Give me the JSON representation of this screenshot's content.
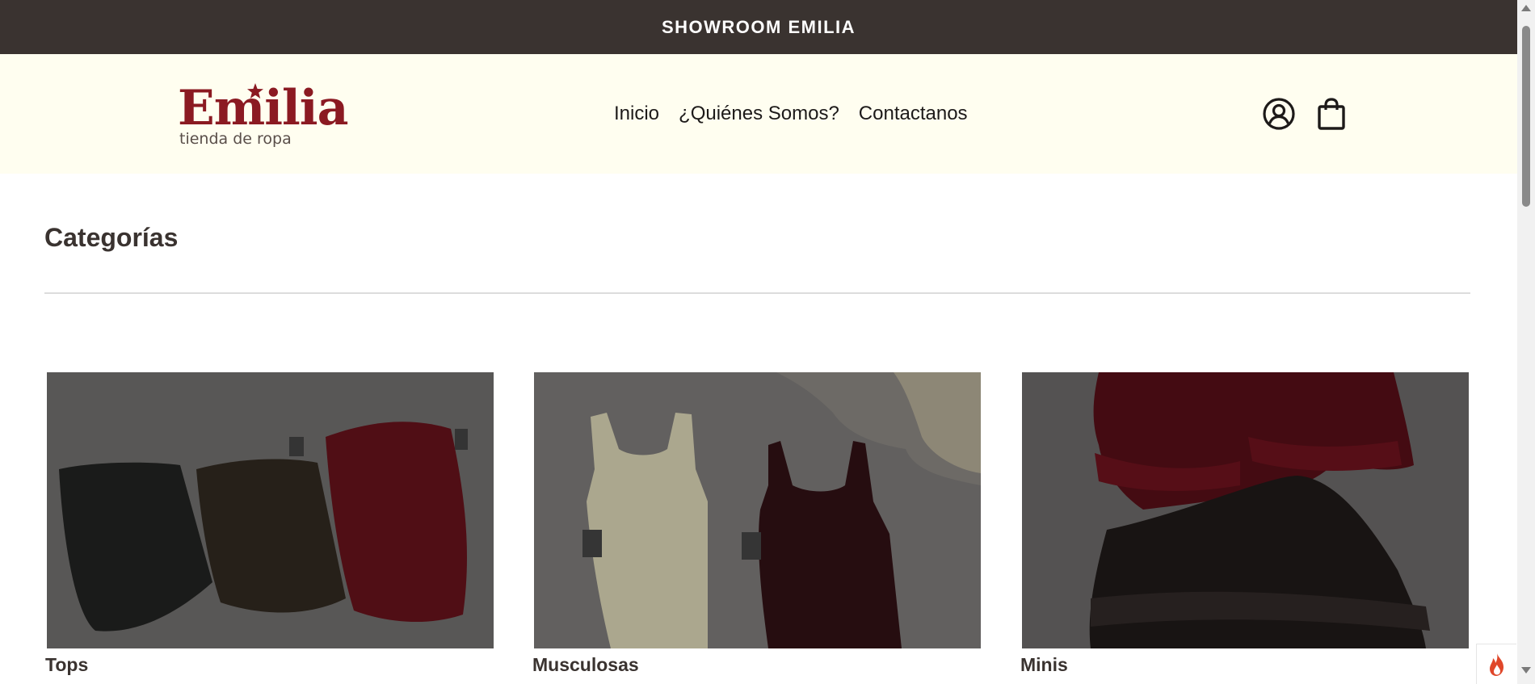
{
  "announcement": {
    "text": "SHOWROOM EMILIA"
  },
  "header": {
    "logo": {
      "word": "Emilia",
      "tagline": "tienda de ropa"
    },
    "nav": [
      {
        "label": "Inicio"
      },
      {
        "label": "¿Quiénes Somos?"
      },
      {
        "label": "Contactanos"
      }
    ],
    "icons": {
      "account": "account-circle-icon",
      "cart": "shopping-bag-icon"
    }
  },
  "main": {
    "section_title": "Categorías",
    "categories": [
      {
        "label": "Tops"
      },
      {
        "label": "Musculosas"
      },
      {
        "label": "Minis"
      }
    ]
  },
  "colors": {
    "announcement_bg": "#3a3330",
    "header_bg": "#fffef0",
    "brand": "#8b1a22",
    "text_dark": "#3a3330"
  },
  "widget": {
    "icon": "flame-icon"
  }
}
